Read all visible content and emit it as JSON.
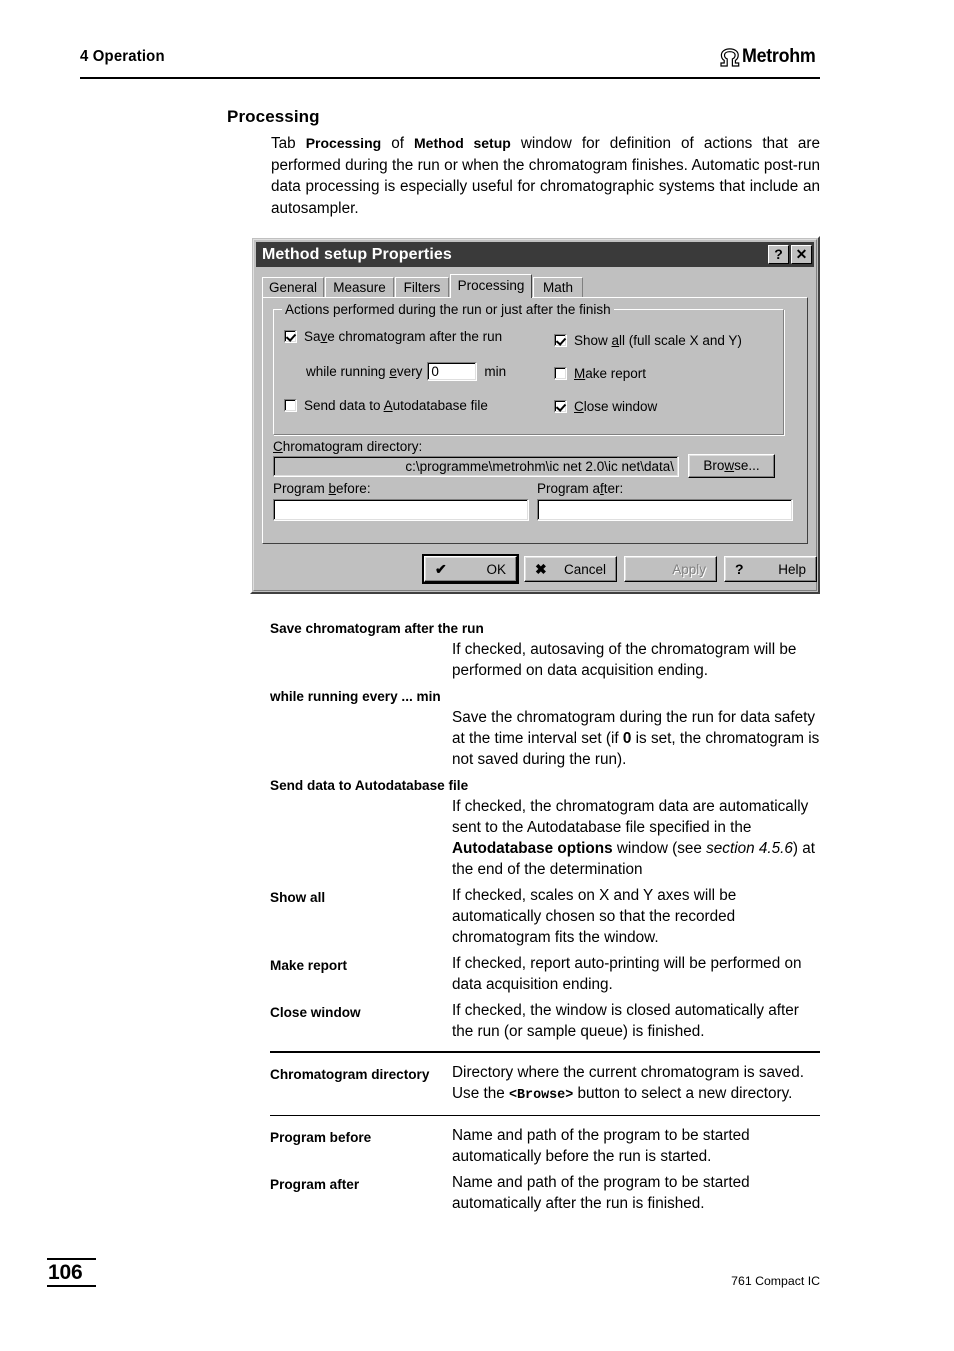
{
  "header": {
    "chapter": "4 Operation",
    "logo_text": "Metrohm",
    "logo_mark": "omega-arch-icon"
  },
  "section": {
    "title": "Processing",
    "intro_prefix": "Tab ",
    "intro_bold1": "Processing",
    "intro_mid": " of ",
    "intro_bold2": "Method setup",
    "intro_rest": " window for definition of actions that are performed during the run or when the chromatogram finishes. Automatic post-run data processing is especially useful for chromatographic systems that include an autosampler."
  },
  "dialog": {
    "title": "Method setup Properties",
    "help_button": "?",
    "close_button": "✕",
    "tabs": [
      {
        "label": "General",
        "active": false
      },
      {
        "label": "Measure",
        "active": false
      },
      {
        "label": "Filters",
        "active": false
      },
      {
        "label": "Processing",
        "active": true
      },
      {
        "label": "Math",
        "active": false
      }
    ],
    "group": {
      "legend": "Actions performed during the run or just after the finish",
      "checkboxes": [
        {
          "label_pre": "Sa",
          "label_accel": "v",
          "label_post": "e chromatogram after the run",
          "checked": true
        },
        {
          "label_pre": "Send data to ",
          "label_accel": "A",
          "label_post": "utodatabase file",
          "checked": false
        },
        {
          "label_pre": "Show ",
          "label_accel": "a",
          "label_post": "ll (full scale X and Y)",
          "checked": true
        },
        {
          "label_pre": "",
          "label_accel": "M",
          "label_post": "ake report",
          "checked": false
        },
        {
          "label_pre": "",
          "label_accel": "C",
          "label_post": "lose window",
          "checked": true
        }
      ],
      "interval_pre": "while running ",
      "interval_accel": "e",
      "interval_post": "very",
      "interval_value": "0",
      "interval_unit": "min"
    },
    "directory": {
      "label_accel": "C",
      "label_pre": "",
      "label_post": "hromatogram directory:",
      "value": "c:\\programme\\metrohm\\ic net 2.0\\ic net\\data\\",
      "browse_pre": "Bro",
      "browse_accel": "w",
      "browse_post": "se..."
    },
    "program_before": {
      "label_pre": "Program ",
      "label_accel": "b",
      "label_post": "efore:",
      "value": ""
    },
    "program_after": {
      "label_pre": "Program a",
      "label_accel": "f",
      "label_post": "ter:",
      "value": ""
    },
    "buttons": [
      {
        "glyph": "✔",
        "label": "OK",
        "state": "default"
      },
      {
        "glyph": "✖",
        "label": "Cancel",
        "state": "normal"
      },
      {
        "glyph": "",
        "label": "Apply",
        "state": "disabled"
      },
      {
        "glyph": "?",
        "label": "Help",
        "state": "normal"
      }
    ]
  },
  "definitions": {
    "block_entries": [
      {
        "term": "Save chromatogram after the run",
        "desc": "If checked, autosaving of the chromatogram will be performed on data acquisition ending."
      },
      {
        "term": "while running every ... min",
        "desc_p1": "Save the chromatogram during the run for data safety at the time interval set (if ",
        "desc_bold": "0",
        "desc_p2": " is set, the chromatogram is not saved during the run)."
      },
      {
        "term": "Send data to Autodatabase file",
        "desc_p1": "If checked, the chromatogram data are automatically sent to the Autodatabase file specified in the ",
        "desc_bold": "Autodatabase options",
        "desc_p2": " window (see ",
        "desc_italic": "section 4.5.6",
        "desc_p3": ") at the end of the determination"
      }
    ],
    "inline_entries": [
      {
        "term": "Show all",
        "desc": "If checked, scales on X and Y axes will be automatically chosen so that the recorded chromatogram fits the window."
      },
      {
        "term": "Make report",
        "desc": "If checked, report auto-printing will be performed on data acquisition ending."
      },
      {
        "term": "Close window",
        "desc": "If checked, the window is closed automatically after the run (or sample queue) is finished."
      }
    ],
    "directory_entry": {
      "term": "Chromatogram directory",
      "desc_p1": "Directory where the current chromatogram is saved. Use the ",
      "desc_mono": "<Browse>",
      "desc_p2": " button to select a new directory."
    },
    "program_entries": [
      {
        "term": "Program before",
        "desc": "Name and path of the program to be started automatically before the run is started."
      },
      {
        "term": "Program after",
        "desc": "Name and path of the program to be started automatically after the run is finished."
      }
    ]
  },
  "footer": {
    "page_number": "106",
    "document": "761 Compact IC"
  }
}
